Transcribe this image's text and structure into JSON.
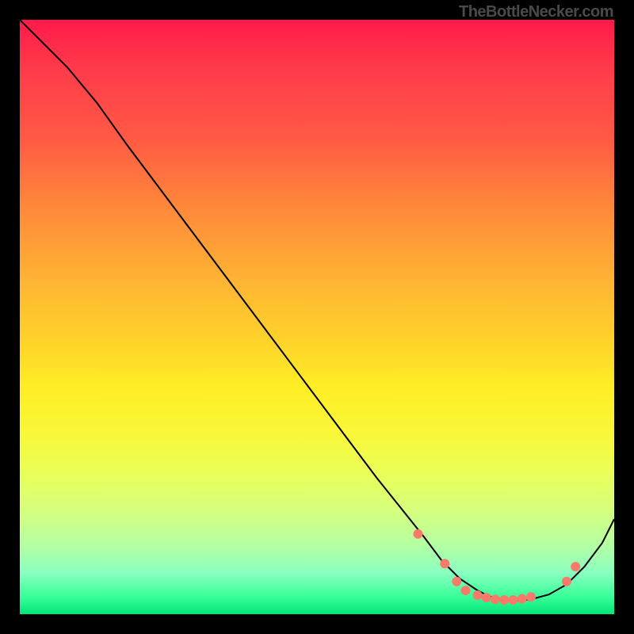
{
  "watermark": "TheBottleNecker.com",
  "chart_data": {
    "type": "line",
    "title": "",
    "xlabel": "",
    "ylabel": "",
    "xlim": [
      0,
      100
    ],
    "ylim": [
      0,
      100
    ],
    "grid": false,
    "series": [
      {
        "name": "curve",
        "x": [
          0,
          4,
          8,
          13,
          18,
          24,
          30,
          36,
          42,
          48,
          54,
          60,
          64,
          68,
          71,
          74,
          77,
          79,
          81,
          83,
          86,
          89,
          92,
          95,
          98,
          100
        ],
        "y": [
          100,
          96,
          92,
          86,
          79,
          71,
          63,
          55,
          47,
          39,
          31,
          23,
          18,
          13,
          9,
          6,
          4,
          3,
          2.4,
          2.2,
          2.5,
          3.3,
          5,
          8,
          12,
          16
        ]
      }
    ],
    "markers": {
      "color": "#f87a6a",
      "radius": 6,
      "points": [
        {
          "x": 67,
          "y": 13.5
        },
        {
          "x": 71.5,
          "y": 8.5
        },
        {
          "x": 73.5,
          "y": 5.5
        },
        {
          "x": 75,
          "y": 4
        },
        {
          "x": 77,
          "y": 3.2
        },
        {
          "x": 78.5,
          "y": 2.8
        },
        {
          "x": 80,
          "y": 2.5
        },
        {
          "x": 81.5,
          "y": 2.4
        },
        {
          "x": 83,
          "y": 2.4
        },
        {
          "x": 84.5,
          "y": 2.6
        },
        {
          "x": 86,
          "y": 2.9
        },
        {
          "x": 92,
          "y": 5.5
        },
        {
          "x": 93.5,
          "y": 8
        }
      ]
    }
  }
}
